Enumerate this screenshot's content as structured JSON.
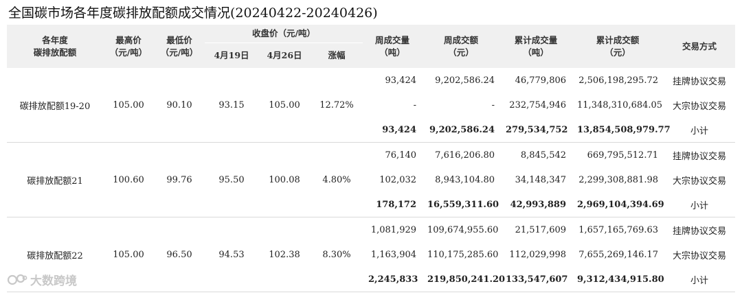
{
  "title": "全国碳市场各年度碳排放配额成交情况(20240422-20240426)",
  "headers": {
    "allowance": [
      "各年度",
      "碳排放配额"
    ],
    "high": [
      "最高价",
      "（元/吨）"
    ],
    "low": [
      "最低价",
      "（元/吨）"
    ],
    "close": "收盘价（元/吨）",
    "apr19": "4月19日",
    "apr26": "4月26日",
    "change": "涨幅",
    "week_vol": [
      "周成交量",
      "（吨）"
    ],
    "week_amt": [
      "周成交额",
      "（元）"
    ],
    "cum_vol": [
      "累计成交量",
      "（吨）"
    ],
    "cum_amt": [
      "累计成交额",
      "（元）"
    ],
    "method": "交易方式"
  },
  "groups": [
    {
      "name": "碳排放配额19-20",
      "high": "105.00",
      "low": "90.10",
      "apr19": "93.15",
      "apr26": "105.00",
      "change": "12.72%",
      "rows": [
        {
          "week_vol": "93,424",
          "week_amt": "9,202,586.24",
          "cum_vol": "46,779,806",
          "cum_amt": "2,506,198,295.72",
          "method": "挂牌协议交易"
        },
        {
          "week_vol": "-",
          "week_amt": "-",
          "cum_vol": "232,754,946",
          "cum_amt": "11,348,310,684.05",
          "method": "大宗协议交易"
        },
        {
          "week_vol": "93,424",
          "week_amt": "9,202,586.24",
          "cum_vol": "279,534,752",
          "cum_amt": "13,854,508,979.77",
          "method": "小计"
        }
      ]
    },
    {
      "name": "碳排放配额21",
      "high": "100.60",
      "low": "99.76",
      "apr19": "95.50",
      "apr26": "100.08",
      "change": "4.80%",
      "rows": [
        {
          "week_vol": "76,140",
          "week_amt": "7,616,206.80",
          "cum_vol": "8,845,542",
          "cum_amt": "669,795,512.71",
          "method": "挂牌协议交易"
        },
        {
          "week_vol": "102,032",
          "week_amt": "8,943,104.80",
          "cum_vol": "34,148,347",
          "cum_amt": "2,299,308,881.98",
          "method": "大宗协议交易"
        },
        {
          "week_vol": "178,172",
          "week_amt": "16,559,311.60",
          "cum_vol": "42,993,889",
          "cum_amt": "2,969,104,394.69",
          "method": "小计"
        }
      ]
    },
    {
      "name": "碳排放配额22",
      "high": "105.00",
      "low": "96.50",
      "apr19": "94.53",
      "apr26": "102.38",
      "change": "8.30%",
      "rows": [
        {
          "week_vol": "1,081,929",
          "week_amt": "109,674,955.60",
          "cum_vol": "21,517,609",
          "cum_amt": "1,657,165,769.63",
          "method": "挂牌协议交易"
        },
        {
          "week_vol": "1,163,904",
          "week_amt": "110,175,285.60",
          "cum_vol": "112,029,998",
          "cum_amt": "7,655,269,146.17",
          "method": "大宗协议交易"
        },
        {
          "week_vol": "2,245,833",
          "week_amt": "219,850,241.20",
          "cum_vol": "133,547,607",
          "cum_amt": "9,312,434,915.80",
          "method": "小计"
        }
      ]
    }
  ],
  "watermark": {
    "text": "大数跨境",
    "icon": "brand-logo-icon"
  }
}
